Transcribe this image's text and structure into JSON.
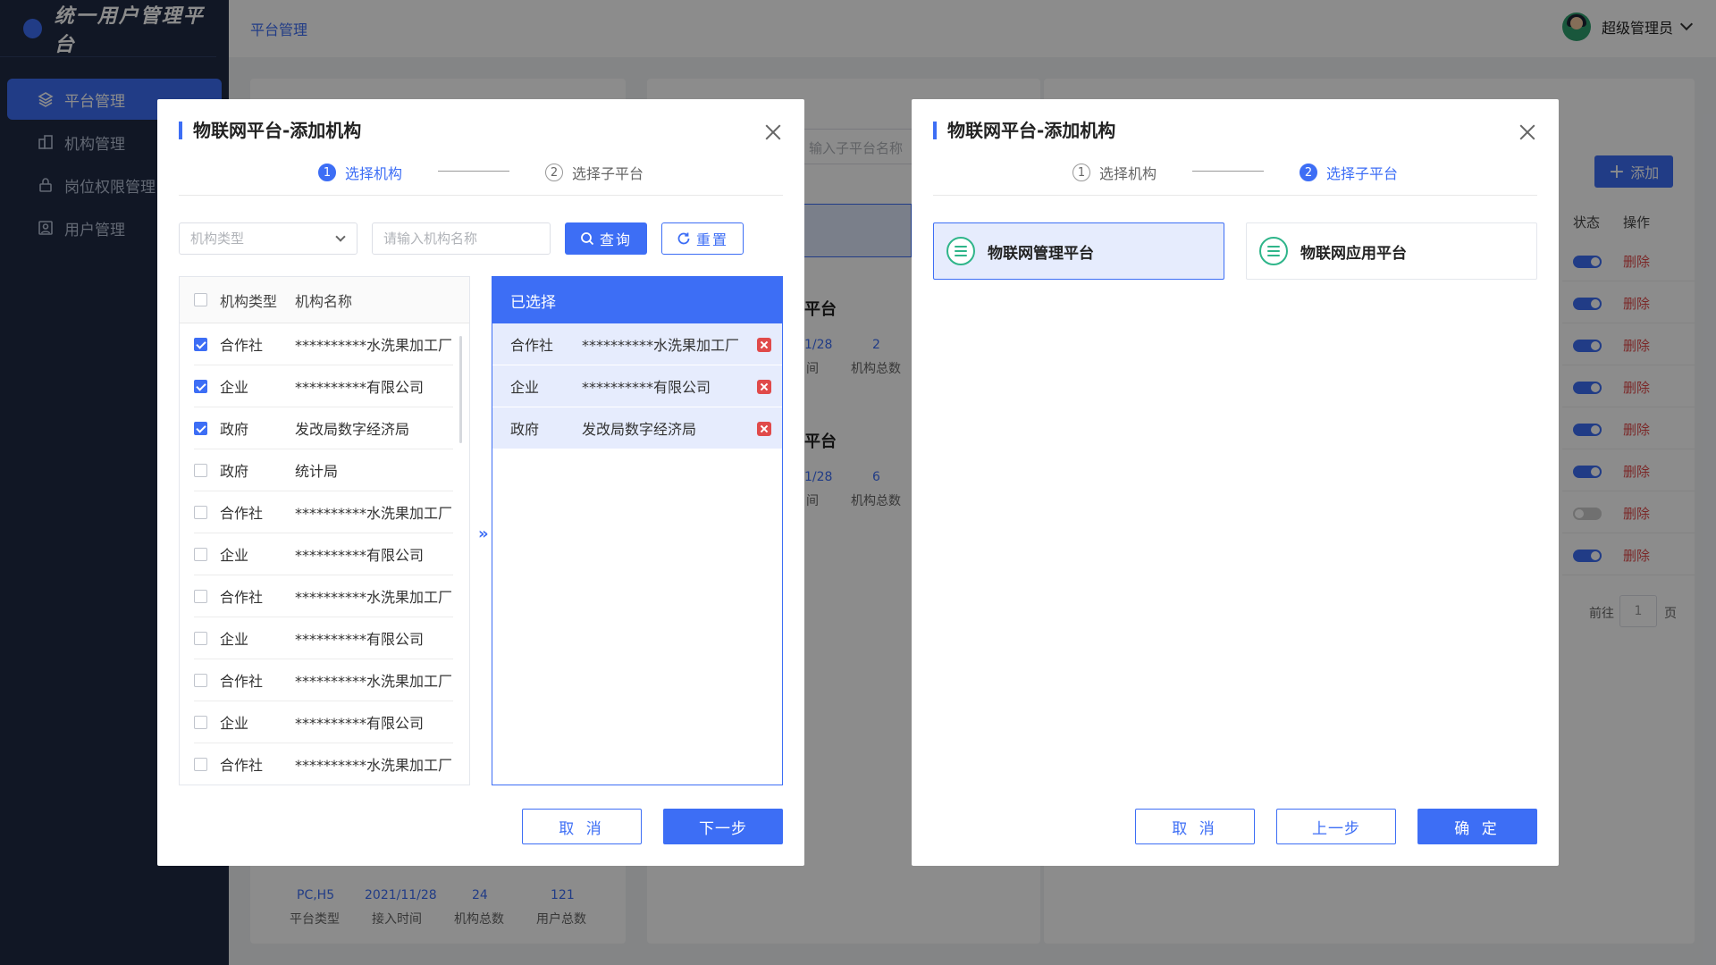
{
  "app": {
    "title": "统一用户管理平台",
    "user_name": "超级管理员",
    "breadcrumb": "平台管理"
  },
  "sidebar": {
    "items": [
      {
        "label": "平台管理",
        "icon": "layers-icon",
        "active": true
      },
      {
        "label": "机构管理",
        "icon": "building-icon",
        "active": false
      },
      {
        "label": "岗位权限管理",
        "icon": "lock-icon",
        "active": false
      },
      {
        "label": "用户管理",
        "icon": "user-icon",
        "active": false
      }
    ]
  },
  "background": {
    "search_placeholder": "输入子平台名称",
    "add_label": "添加",
    "col_status": "状态",
    "col_action": "操作",
    "delete_label": "删除",
    "card_titles": [
      "平台",
      "平台"
    ],
    "card_stats": [
      {
        "date": "1/28",
        "count": "2",
        "time_label": "间",
        "count_label": "机构总数"
      },
      {
        "date": "1/28",
        "count": "6",
        "time_label": "间",
        "count_label": "机构总数"
      }
    ],
    "bottom_card": {
      "values": [
        "PC,H5",
        "2021/11/28",
        "24",
        "121"
      ],
      "labels": [
        "平台类型",
        "接入时间",
        "机构总数",
        "用户总数"
      ]
    },
    "toggles": [
      true,
      true,
      true,
      true,
      true,
      true,
      false,
      true
    ],
    "pagination": {
      "goto": "前往",
      "page": "1",
      "page_suffix": "页"
    }
  },
  "dialog1": {
    "title": "物联网平台-添加机构",
    "steps": [
      {
        "num": "1",
        "label": "选择机构"
      },
      {
        "num": "2",
        "label": "选择子平台"
      }
    ],
    "active_step": 1,
    "org_type_placeholder": "机构类型",
    "org_name_placeholder": "请输入机构名称",
    "query_label": "查询",
    "reset_label": "重置",
    "list_headers": {
      "type": "机构类型",
      "name": "机构名称"
    },
    "list_rows": [
      {
        "checked": true,
        "type": "合作社",
        "name": "**********水洗果加工厂"
      },
      {
        "checked": true,
        "type": "企业",
        "name": "**********有限公司"
      },
      {
        "checked": true,
        "type": "政府",
        "name": "发改局数字经济局"
      },
      {
        "checked": false,
        "type": "政府",
        "name": "统计局"
      },
      {
        "checked": false,
        "type": "合作社",
        "name": "**********水洗果加工厂"
      },
      {
        "checked": false,
        "type": "企业",
        "name": "**********有限公司"
      },
      {
        "checked": false,
        "type": "合作社",
        "name": "**********水洗果加工厂"
      },
      {
        "checked": false,
        "type": "企业",
        "name": "**********有限公司"
      },
      {
        "checked": false,
        "type": "合作社",
        "name": "**********水洗果加工厂"
      },
      {
        "checked": false,
        "type": "企业",
        "name": "**********有限公司"
      },
      {
        "checked": false,
        "type": "合作社",
        "name": "**********水洗果加工厂"
      }
    ],
    "transfer_symbol": "»",
    "selected_header": "已选择",
    "selected_rows": [
      {
        "type": "合作社",
        "name": "**********水洗果加工厂"
      },
      {
        "type": "企业",
        "name": "**********有限公司"
      },
      {
        "type": "政府",
        "name": "发改局数字经济局"
      }
    ],
    "cancel_label": "取 消",
    "next_label": "下一步"
  },
  "dialog2": {
    "title": "物联网平台-添加机构",
    "steps": [
      {
        "num": "1",
        "label": "选择机构"
      },
      {
        "num": "2",
        "label": "选择子平台"
      }
    ],
    "active_step": 2,
    "platforms": [
      {
        "label": "物联网管理平台",
        "selected": true
      },
      {
        "label": "物联网应用平台",
        "selected": false
      }
    ],
    "cancel_label": "取 消",
    "prev_label": "上一步",
    "confirm_label": "确 定"
  },
  "colors": {
    "accent": "#3d6ef5",
    "sidebar_bg": "#1f2a44",
    "danger": "#e04a4a",
    "platform_icon": "#2fb58a"
  }
}
